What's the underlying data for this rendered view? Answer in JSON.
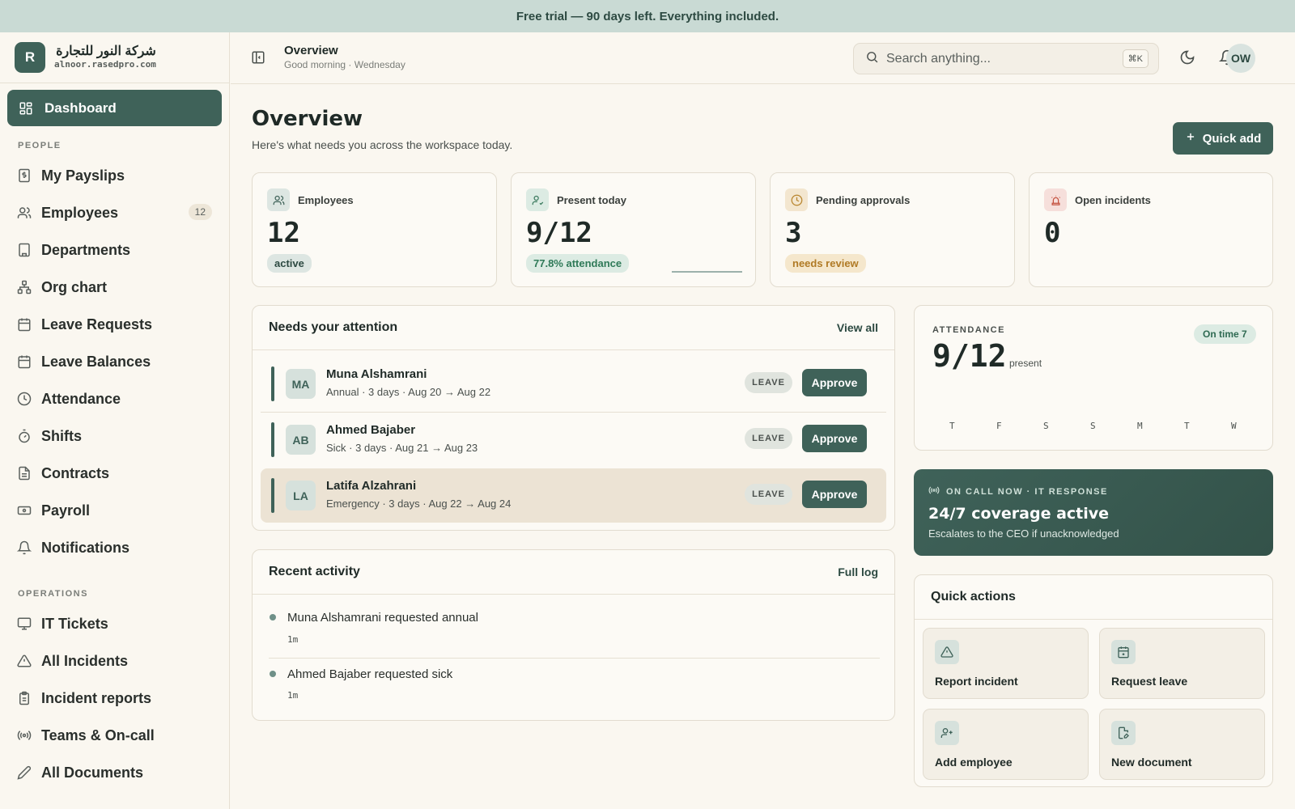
{
  "banner": {
    "text": "Free trial — 90 days left. Everything included."
  },
  "brand": {
    "logo_letter": "R",
    "name": "شركة النور للتجارة",
    "domain": "alnoor.rasedpro.com"
  },
  "sidebar": {
    "active": {
      "label": "Dashboard",
      "icon": "grid-icon"
    },
    "sections": [
      {
        "title": "PEOPLE",
        "items": [
          {
            "label": "My Payslips",
            "icon": "dollar-doc-icon"
          },
          {
            "label": "Employees",
            "icon": "users-icon",
            "badge": "12"
          },
          {
            "label": "Departments",
            "icon": "building-icon"
          },
          {
            "label": "Org chart",
            "icon": "org-chart-icon"
          },
          {
            "label": "Leave Requests",
            "icon": "calendar-icon"
          },
          {
            "label": "Leave Balances",
            "icon": "calendar-grid-icon"
          },
          {
            "label": "Attendance",
            "icon": "clock-icon"
          },
          {
            "label": "Shifts",
            "icon": "timer-icon"
          },
          {
            "label": "Contracts",
            "icon": "document-icon"
          },
          {
            "label": "Payroll",
            "icon": "banknote-icon"
          },
          {
            "label": "Notifications",
            "icon": "bell-icon"
          }
        ]
      },
      {
        "title": "OPERATIONS",
        "items": [
          {
            "label": "IT Tickets",
            "icon": "monitor-icon"
          },
          {
            "label": "All Incidents",
            "icon": "warning-icon"
          },
          {
            "label": "Incident reports",
            "icon": "clipboard-icon"
          },
          {
            "label": "Teams & On-call",
            "icon": "radio-icon"
          },
          {
            "label": "All Documents",
            "icon": "pen-icon"
          }
        ]
      }
    ]
  },
  "topbar": {
    "title": "Overview",
    "subtitle": "Good morning · Wednesday",
    "search_placeholder": "Search anything...",
    "search_shortcut": "⌘K",
    "avatar_initials": "OW"
  },
  "page": {
    "title": "Overview",
    "subtitle": "Here's what needs you across the workspace today.",
    "quick_add_label": "Quick add"
  },
  "stats": [
    {
      "label": "Employees",
      "value": "12",
      "pill": "active",
      "icon": "users-icon"
    },
    {
      "label": "Present today",
      "value": "9/12",
      "pill": "77.8% attendance",
      "icon": "user-check-icon"
    },
    {
      "label": "Pending approvals",
      "value": "3",
      "pill": "needs review",
      "icon": "clock-icon"
    },
    {
      "label": "Open incidents",
      "value": "0",
      "pill": "",
      "icon": "siren-icon"
    }
  ],
  "attention": {
    "title": "Needs your attention",
    "link": "View all",
    "rows": [
      {
        "initials": "MA",
        "name": "Muna Alshamrani",
        "detail": "Annual · 3 days · Aug 20 → Aug 22",
        "tag": "LEAVE",
        "action": "Approve"
      },
      {
        "initials": "AB",
        "name": "Ahmed Bajaber",
        "detail": "Sick · 3 days · Aug 21 → Aug 23",
        "tag": "LEAVE",
        "action": "Approve"
      },
      {
        "initials": "LA",
        "name": "Latifa Alzahrani",
        "detail": "Emergency · 3 days · Aug 22 → Aug 24",
        "tag": "LEAVE",
        "action": "Approve"
      }
    ]
  },
  "activity": {
    "title": "Recent activity",
    "link": "Full log",
    "items": [
      {
        "text": "Muna Alshamrani requested annual",
        "time": "1m"
      },
      {
        "text": "Ahmed Bajaber requested sick",
        "time": "1m"
      }
    ]
  },
  "attendance_card": {
    "label": "ATTENDANCE",
    "value": "9/12",
    "unit": "present",
    "badge": "On time 7",
    "days": [
      "T",
      "F",
      "S",
      "S",
      "M",
      "T",
      "W"
    ]
  },
  "oncall": {
    "label": "ON CALL NOW · IT RESPONSE",
    "title": "24/7 coverage active",
    "subtitle": "Escalates to the CEO if unacknowledged"
  },
  "quick_actions": {
    "title": "Quick actions",
    "items": [
      {
        "label": "Report incident",
        "icon": "warning-icon"
      },
      {
        "label": "Request leave",
        "icon": "calendar-plus-icon"
      },
      {
        "label": "Add employee",
        "icon": "user-plus-icon"
      },
      {
        "label": "New document",
        "icon": "file-edit-icon"
      }
    ]
  }
}
